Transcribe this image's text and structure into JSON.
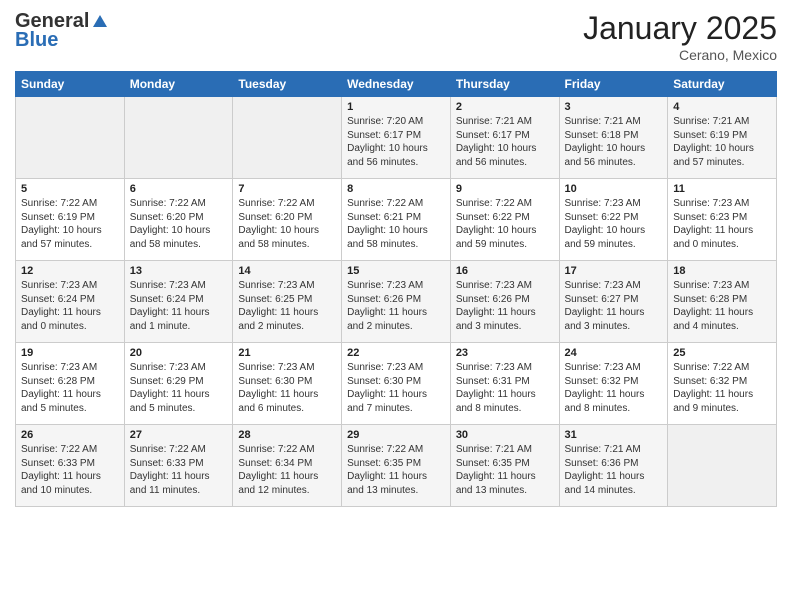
{
  "logo": {
    "general": "General",
    "blue": "Blue"
  },
  "title": "January 2025",
  "location": "Cerano, Mexico",
  "days_header": [
    "Sunday",
    "Monday",
    "Tuesday",
    "Wednesday",
    "Thursday",
    "Friday",
    "Saturday"
  ],
  "weeks": [
    [
      {
        "num": "",
        "info": ""
      },
      {
        "num": "",
        "info": ""
      },
      {
        "num": "",
        "info": ""
      },
      {
        "num": "1",
        "info": "Sunrise: 7:20 AM\nSunset: 6:17 PM\nDaylight: 10 hours\nand 56 minutes."
      },
      {
        "num": "2",
        "info": "Sunrise: 7:21 AM\nSunset: 6:17 PM\nDaylight: 10 hours\nand 56 minutes."
      },
      {
        "num": "3",
        "info": "Sunrise: 7:21 AM\nSunset: 6:18 PM\nDaylight: 10 hours\nand 56 minutes."
      },
      {
        "num": "4",
        "info": "Sunrise: 7:21 AM\nSunset: 6:19 PM\nDaylight: 10 hours\nand 57 minutes."
      }
    ],
    [
      {
        "num": "5",
        "info": "Sunrise: 7:22 AM\nSunset: 6:19 PM\nDaylight: 10 hours\nand 57 minutes."
      },
      {
        "num": "6",
        "info": "Sunrise: 7:22 AM\nSunset: 6:20 PM\nDaylight: 10 hours\nand 58 minutes."
      },
      {
        "num": "7",
        "info": "Sunrise: 7:22 AM\nSunset: 6:20 PM\nDaylight: 10 hours\nand 58 minutes."
      },
      {
        "num": "8",
        "info": "Sunrise: 7:22 AM\nSunset: 6:21 PM\nDaylight: 10 hours\nand 58 minutes."
      },
      {
        "num": "9",
        "info": "Sunrise: 7:22 AM\nSunset: 6:22 PM\nDaylight: 10 hours\nand 59 minutes."
      },
      {
        "num": "10",
        "info": "Sunrise: 7:23 AM\nSunset: 6:22 PM\nDaylight: 10 hours\nand 59 minutes."
      },
      {
        "num": "11",
        "info": "Sunrise: 7:23 AM\nSunset: 6:23 PM\nDaylight: 11 hours\nand 0 minutes."
      }
    ],
    [
      {
        "num": "12",
        "info": "Sunrise: 7:23 AM\nSunset: 6:24 PM\nDaylight: 11 hours\nand 0 minutes."
      },
      {
        "num": "13",
        "info": "Sunrise: 7:23 AM\nSunset: 6:24 PM\nDaylight: 11 hours\nand 1 minute."
      },
      {
        "num": "14",
        "info": "Sunrise: 7:23 AM\nSunset: 6:25 PM\nDaylight: 11 hours\nand 2 minutes."
      },
      {
        "num": "15",
        "info": "Sunrise: 7:23 AM\nSunset: 6:26 PM\nDaylight: 11 hours\nand 2 minutes."
      },
      {
        "num": "16",
        "info": "Sunrise: 7:23 AM\nSunset: 6:26 PM\nDaylight: 11 hours\nand 3 minutes."
      },
      {
        "num": "17",
        "info": "Sunrise: 7:23 AM\nSunset: 6:27 PM\nDaylight: 11 hours\nand 3 minutes."
      },
      {
        "num": "18",
        "info": "Sunrise: 7:23 AM\nSunset: 6:28 PM\nDaylight: 11 hours\nand 4 minutes."
      }
    ],
    [
      {
        "num": "19",
        "info": "Sunrise: 7:23 AM\nSunset: 6:28 PM\nDaylight: 11 hours\nand 5 minutes."
      },
      {
        "num": "20",
        "info": "Sunrise: 7:23 AM\nSunset: 6:29 PM\nDaylight: 11 hours\nand 5 minutes."
      },
      {
        "num": "21",
        "info": "Sunrise: 7:23 AM\nSunset: 6:30 PM\nDaylight: 11 hours\nand 6 minutes."
      },
      {
        "num": "22",
        "info": "Sunrise: 7:23 AM\nSunset: 6:30 PM\nDaylight: 11 hours\nand 7 minutes."
      },
      {
        "num": "23",
        "info": "Sunrise: 7:23 AM\nSunset: 6:31 PM\nDaylight: 11 hours\nand 8 minutes."
      },
      {
        "num": "24",
        "info": "Sunrise: 7:23 AM\nSunset: 6:32 PM\nDaylight: 11 hours\nand 8 minutes."
      },
      {
        "num": "25",
        "info": "Sunrise: 7:22 AM\nSunset: 6:32 PM\nDaylight: 11 hours\nand 9 minutes."
      }
    ],
    [
      {
        "num": "26",
        "info": "Sunrise: 7:22 AM\nSunset: 6:33 PM\nDaylight: 11 hours\nand 10 minutes."
      },
      {
        "num": "27",
        "info": "Sunrise: 7:22 AM\nSunset: 6:33 PM\nDaylight: 11 hours\nand 11 minutes."
      },
      {
        "num": "28",
        "info": "Sunrise: 7:22 AM\nSunset: 6:34 PM\nDaylight: 11 hours\nand 12 minutes."
      },
      {
        "num": "29",
        "info": "Sunrise: 7:22 AM\nSunset: 6:35 PM\nDaylight: 11 hours\nand 13 minutes."
      },
      {
        "num": "30",
        "info": "Sunrise: 7:21 AM\nSunset: 6:35 PM\nDaylight: 11 hours\nand 13 minutes."
      },
      {
        "num": "31",
        "info": "Sunrise: 7:21 AM\nSunset: 6:36 PM\nDaylight: 11 hours\nand 14 minutes."
      },
      {
        "num": "",
        "info": ""
      }
    ]
  ]
}
